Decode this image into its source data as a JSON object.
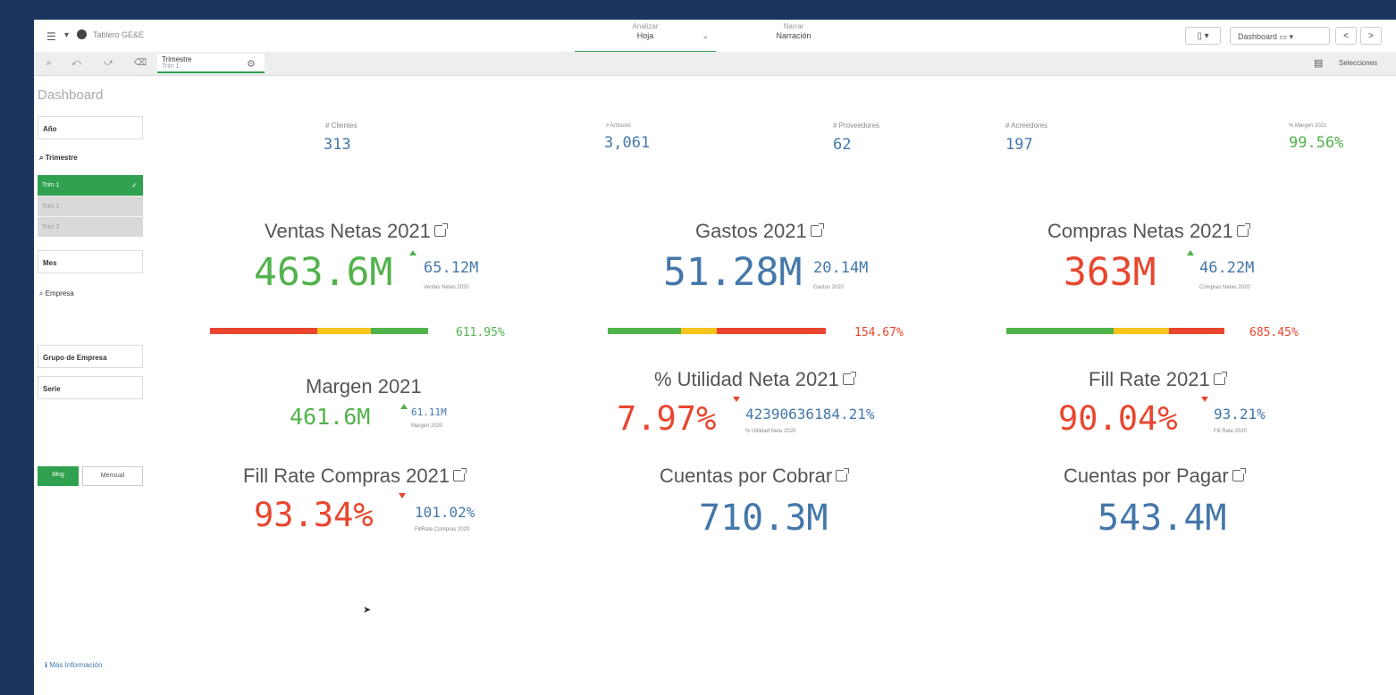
{
  "app": {
    "name": "Tablero GE&E"
  },
  "nav": {
    "analyze_small": "Analizar",
    "analyze_big": "Hoja",
    "narrate_small": "Narrar",
    "narrate_big": "Narración"
  },
  "toolbar": {
    "sheet_label": "Dashboard",
    "prev": "<",
    "next": ">"
  },
  "selections": {
    "chip_title": "Trimestre",
    "chip_value": "Trim 1",
    "right_label": "Selecciones"
  },
  "sidebar": {
    "title": "Dashboard",
    "year_filter": "Año",
    "trimestre_label": "Trimestre",
    "options": [
      "Trim 1",
      "Trim 1",
      "Trim 2"
    ],
    "month_filter": "Mes",
    "empresa_label": "Empresa",
    "group_filter": "Grupo de Empresa",
    "serie_filter": "Serie",
    "btn_a": "Mng",
    "btn_b": "Mensual",
    "info_link": "ℹ Más Información"
  },
  "kpis": [
    {
      "label": "# Clientes",
      "value": "313"
    },
    {
      "label": "# Artículos",
      "value": "3,061"
    },
    {
      "label": "# Proveedores",
      "value": "62"
    },
    {
      "label": "# Acreedores",
      "value": "197"
    },
    {
      "label": "% Margen 2021",
      "value": "99.56%"
    }
  ],
  "panels": {
    "ventas": {
      "title": "Ventas Netas 2021",
      "value": "463.6M",
      "compare_value": "65.12M",
      "compare_label": "Ventas Netas 2020",
      "pct": "611.95%"
    },
    "gastos": {
      "title": "Gastos 2021",
      "value": "51.28M",
      "compare_value": "20.14M",
      "compare_label": "Gastos 2020",
      "pct": "154.67%"
    },
    "compras": {
      "title": "Compras Netas 2021",
      "value": "363M",
      "compare_value": "46.22M",
      "compare_label": "Compras Netas 2020",
      "pct": "685.45%"
    },
    "margen": {
      "title": "Margen 2021",
      "value": "461.6M",
      "compare_value": "61.11M",
      "compare_label": "Margen 2020"
    },
    "utilidad": {
      "title": "% Utilidad Neta 2021",
      "value": "7.97%",
      "compare_value": "42390636184.21%",
      "compare_label": "% Utilidad Neta 2020"
    },
    "fillrate": {
      "title": "Fill Rate 2021",
      "value": "90.04%",
      "compare_value": "93.21%",
      "compare_label": "Fill Rate 2020"
    },
    "fillrate_compras": {
      "title": "Fill Rate Compras 2021",
      "value": "93.34%",
      "compare_value": "101.02%",
      "compare_label": "FillRate Compras 2020"
    },
    "cobrar": {
      "title": "Cuentas por Cobrar",
      "value": "710.3M"
    },
    "pagar": {
      "title": "Cuentas por Pagar",
      "value": "543.4M"
    }
  },
  "colors": {
    "green": "#52b24c",
    "red": "#e8462f",
    "blue": "#4477aa",
    "yellow": "#f6c41c",
    "frame": "#1c355e"
  }
}
